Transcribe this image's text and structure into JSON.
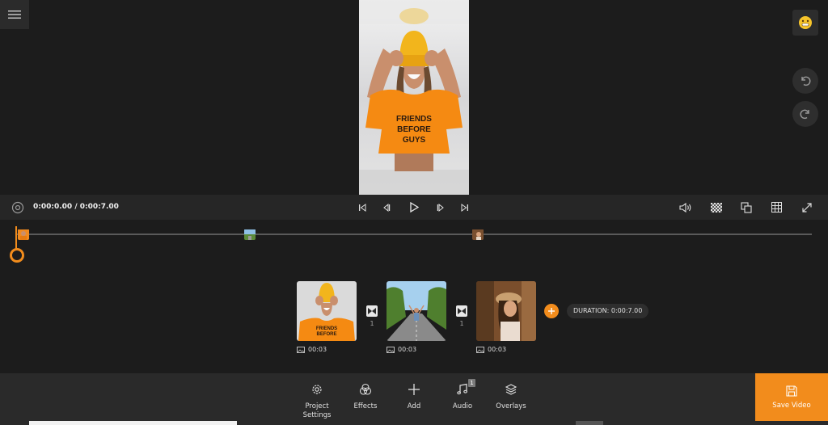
{
  "playback": {
    "time": "0:00:0.00 / 0:00:7.00"
  },
  "clips": [
    {
      "duration": "00:03"
    },
    {
      "duration": "00:03"
    },
    {
      "duration": "00:03"
    }
  ],
  "transitions": [
    {
      "count": "1"
    },
    {
      "count": "1"
    }
  ],
  "duration_badge": "DURATION: 0:00:7.00",
  "toolbar": {
    "project_settings": "Project\nSettings",
    "effects": "Effects",
    "add": "Add",
    "audio": "Audio",
    "audio_badge": "1",
    "overlays": "Overlays",
    "save_video": "Save Video"
  },
  "progress": 0.27,
  "colors": {
    "accent": "#f28c1c",
    "background": "#1c1c1c",
    "toolbar": "#2a2a2a"
  },
  "icons": [
    "menu-icon",
    "emoji-icon",
    "undo-icon",
    "redo-icon",
    "settings-icon",
    "skip-start-icon",
    "frame-back-icon",
    "play-icon",
    "frame-forward-icon",
    "skip-end-icon",
    "volume-icon",
    "checker-icon",
    "aspect-icon",
    "grid-icon",
    "fullscreen-icon",
    "image-icon",
    "transition-icon",
    "plus-icon",
    "gear-icon",
    "effects-icon",
    "music-icon",
    "layers-icon",
    "save-icon"
  ]
}
